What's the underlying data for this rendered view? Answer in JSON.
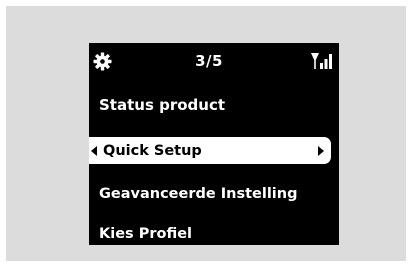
{
  "status_bar": {
    "page_counter": "3/5",
    "settings_icon": "gear-icon",
    "signal_icon": "signal-strength-icon"
  },
  "menu": {
    "items": [
      {
        "label": "Status product",
        "selected": false
      },
      {
        "label": "Quick Setup",
        "selected": true
      },
      {
        "label": "Geavanceerde Instelling",
        "selected": false
      },
      {
        "label": "Kies Profiel",
        "selected": false
      }
    ]
  },
  "colors": {
    "screen_background": "#000000",
    "text": "#ffffff",
    "highlight_background": "#ffffff",
    "highlight_text": "#000000",
    "panel_background": "#dcdcdc"
  }
}
